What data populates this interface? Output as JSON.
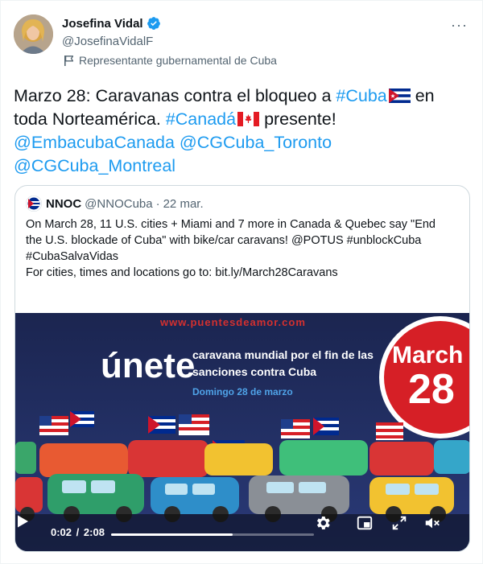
{
  "author": {
    "name": "Josefina Vidal",
    "handle": "@JosefinaVidalF",
    "label": "Representante gubernamental de Cuba"
  },
  "tweet": {
    "line1_text": "Marzo 28: Caravanas contra el bloqueo a ",
    "line1_hashtag": "#Cuba",
    "line1_tail": " en",
    "line2_text": "toda Norteamérica. ",
    "line2_hashtag": "#Canadá",
    "line2_tail": " presente!",
    "mention1": "@EmbacubaCanada",
    "mention2": "@CGCuba_Toronto",
    "mention3": "@CGCuba_Montreal"
  },
  "quote": {
    "name": "NNOC",
    "handle": "@NNOCuba",
    "dot": "·",
    "date": "22 mar.",
    "lines": [
      "On March 28, 11 U.S. cities + Miami and 7 more in Canada & Quebec say \"End",
      "the U.S. blockade of Cuba\" with bike/car caravans! @POTUS #unblockCuba",
      "#CubaSalvaVidas",
      "For cities, times and locations go to: bit.ly/March28Caravans"
    ]
  },
  "media": {
    "url_text": "www.puentesdeamor.com",
    "unete": "únete",
    "sub1": "caravana mundial por el fin de las",
    "sub2": "sanciones contra Cuba",
    "date_text": "Domingo 28 de marzo",
    "badge_month": "March",
    "badge_day": "28"
  },
  "video": {
    "current": "0:02",
    "separator": "/",
    "duration": "2:08",
    "progress": 0.6
  },
  "colors": {
    "link": "#1d9bf0",
    "verified": "#1d9bf0",
    "muted": "#536471",
    "poster_bg": "#1f2a55",
    "badge_red": "#d61f26"
  },
  "icons": [
    "verified-badge-icon",
    "more-icon",
    "flag-icon",
    "play-icon",
    "settings-icon",
    "pip-icon",
    "fullscreen-icon",
    "volume-icon"
  ]
}
